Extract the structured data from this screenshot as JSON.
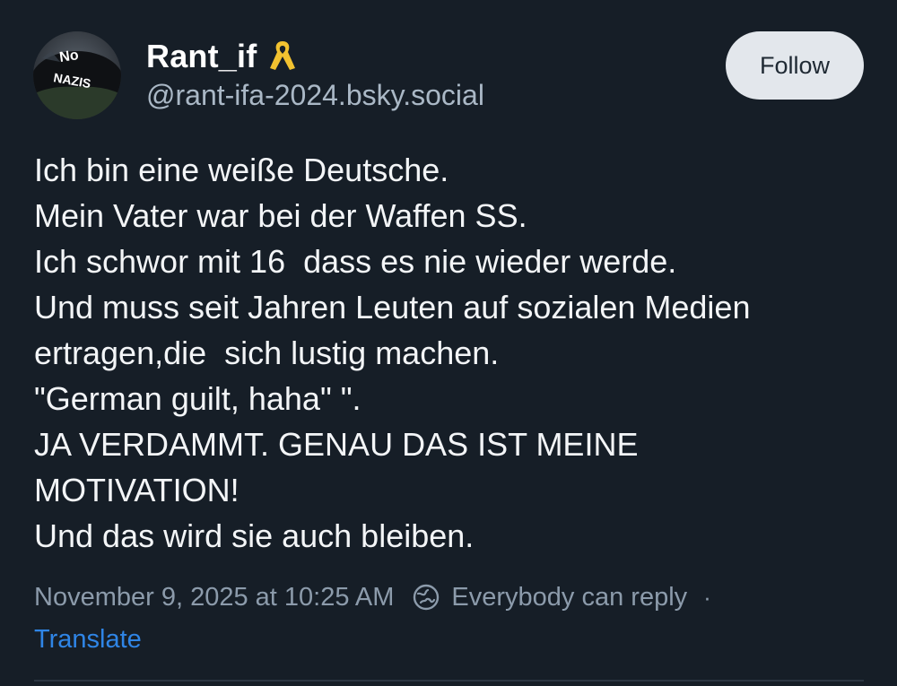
{
  "author": {
    "display_name": "Rant_if",
    "handle": "@rant-ifa-2024.bsky.social",
    "avatar_text": [
      "No",
      "NAZIS"
    ],
    "badge_icon": "yellow-ribbon-icon"
  },
  "follow_label": "Follow",
  "post": {
    "lines": [
      "Ich bin eine weiße Deutsche.",
      "Mein Vater war bei der Waffen SS.",
      "Ich schwor mit 16  dass es nie wieder werde.",
      "Und muss seit Jahren Leuten auf sozialen Medien",
      "ertragen,die  sich lustig machen.",
      "\"German guilt, haha\" \".",
      "JA VERDAMMT. GENAU DAS IST MEINE",
      "MOTIVATION!",
      "Und das wird sie auch bleiben."
    ]
  },
  "meta": {
    "timestamp": "November 9, 2025 at 10:25 AM",
    "reply_setting": "Everybody can reply",
    "separator": "·"
  },
  "translate_label": "Translate",
  "colors": {
    "background": "#161e27",
    "text": "#f3f5f7",
    "muted": "#8c9bab",
    "link": "#2f85e6",
    "ribbon": "#f2c230"
  }
}
